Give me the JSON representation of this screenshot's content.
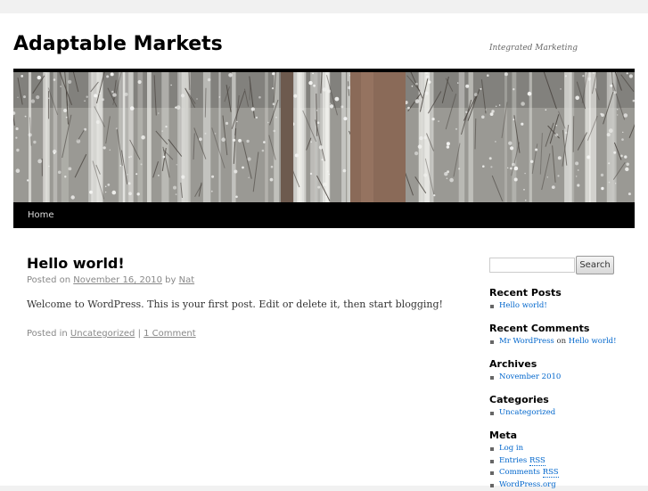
{
  "site": {
    "title": "Adaptable Markets",
    "description": "Integrated Marketing"
  },
  "nav": {
    "home": "Home"
  },
  "post": {
    "title": "Hello world!",
    "posted_on": "Posted on",
    "date": "November 16, 2010",
    "by": "by",
    "author": "Nat",
    "content": "Welcome to WordPress. This is your first post. Edit or delete it, then start blogging!",
    "posted_in": "Posted in",
    "category": "Uncategorized",
    "separator": "|",
    "comments": "1 Comment"
  },
  "sidebar": {
    "search": {
      "placeholder": "",
      "button": "Search"
    },
    "recent_posts": {
      "title": "Recent Posts",
      "items": [
        "Hello world!"
      ]
    },
    "recent_comments": {
      "title": "Recent Comments",
      "author": "Mr WordPress",
      "on": "on",
      "post": "Hello world!"
    },
    "archives": {
      "title": "Archives",
      "items": [
        "November 2010"
      ]
    },
    "categories": {
      "title": "Categories",
      "items": [
        "Uncategorized"
      ]
    },
    "meta": {
      "title": "Meta",
      "items": [
        "Log in",
        "Entries",
        "RSS",
        "Comments",
        "RSS",
        "WordPress.org"
      ]
    }
  },
  "colors": {
    "link": "#0066cc",
    "menu_bar": "#000000",
    "meta_text": "#888888"
  }
}
